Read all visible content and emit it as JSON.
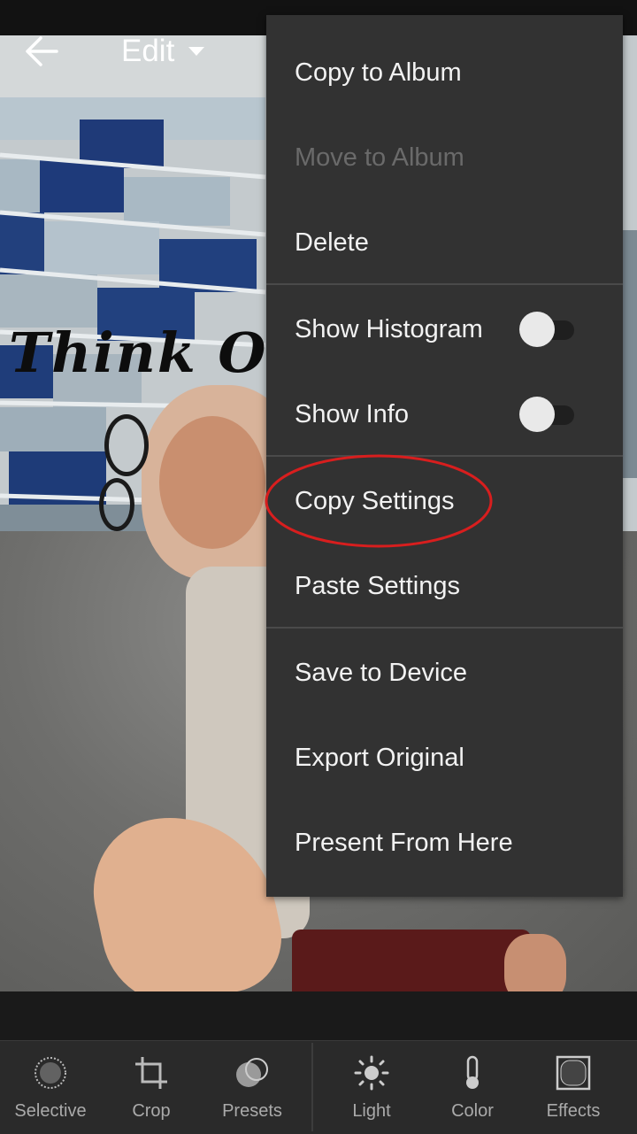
{
  "header": {
    "title": "Edit"
  },
  "photo": {
    "overlay_text": "Think Oran"
  },
  "menu": {
    "items": [
      {
        "label": "Copy to Album",
        "enabled": true
      },
      {
        "label": "Move to Album",
        "enabled": false
      },
      {
        "label": "Delete",
        "enabled": true
      },
      {
        "label": "Show Histogram",
        "toggle": false
      },
      {
        "label": "Show Info",
        "toggle": false
      },
      {
        "label": "Copy Settings",
        "highlighted": true
      },
      {
        "label": "Paste Settings"
      },
      {
        "label": "Save to Device"
      },
      {
        "label": "Export Original"
      },
      {
        "label": "Present From Here"
      }
    ]
  },
  "toolbar": {
    "tools": [
      {
        "label": "Selective",
        "icon": "selective-icon"
      },
      {
        "label": "Crop",
        "icon": "crop-icon"
      },
      {
        "label": "Presets",
        "icon": "presets-icon"
      },
      {
        "label": "Light",
        "icon": "light-icon"
      },
      {
        "label": "Color",
        "icon": "color-icon"
      },
      {
        "label": "Effects",
        "icon": "effects-icon"
      }
    ]
  },
  "colors": {
    "menu_bg": "#323232",
    "highlight": "#d81e1e",
    "toolbar_bg": "#2a2a2a"
  }
}
